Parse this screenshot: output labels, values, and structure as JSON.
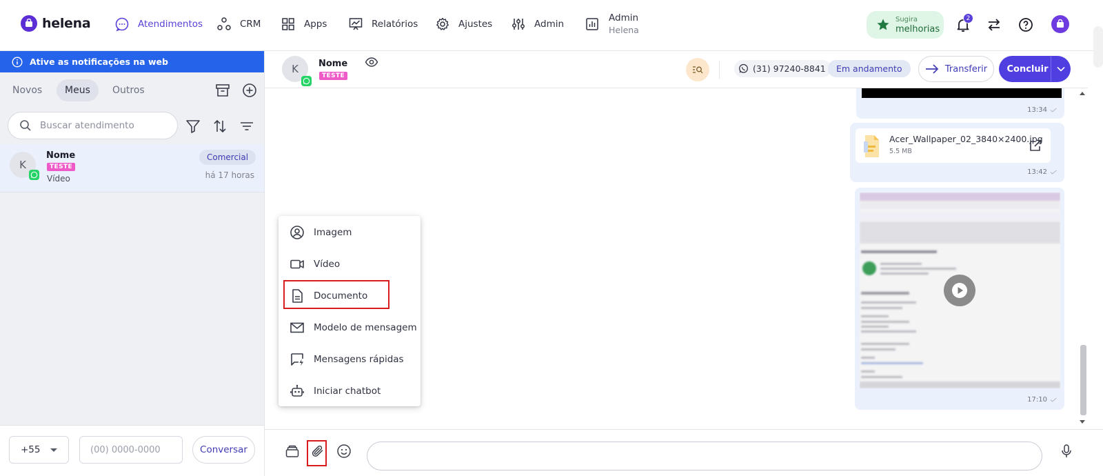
{
  "brand": {
    "name": "helena",
    "accent": "#5b3fd9"
  },
  "nav": {
    "items": [
      {
        "label": "Atendimentos",
        "icon": "chat-bubble-icon"
      },
      {
        "label": "CRM",
        "icon": "crm-nodes-icon"
      },
      {
        "label": "Apps",
        "icon": "grid-icon"
      },
      {
        "label": "Relatórios",
        "icon": "chart-board-icon"
      },
      {
        "label": "Ajustes",
        "icon": "gear-icon"
      },
      {
        "label": "Admin",
        "icon": "sliders-icon"
      }
    ],
    "account": {
      "title": "Admin",
      "subtitle": "Helena"
    },
    "suggest": {
      "line1": "Sugira",
      "line2": "melhorias"
    },
    "notifications_count": "2"
  },
  "left_panel": {
    "notify_bar": "Ative as notificações na web",
    "tabs": [
      "Novos",
      "Meus",
      "Outros"
    ],
    "active_tab": "Meus",
    "search_placeholder": "Buscar atendimento",
    "conversation": {
      "initial": "K",
      "name": "Nome",
      "tag": "TESTE",
      "last_message": "Vídeo",
      "department": "Comercial",
      "time": "há 17 horas"
    },
    "footer": {
      "ddi": "+55",
      "phone_placeholder": "(00) 0000-0000",
      "button": "Conversar"
    }
  },
  "chat_header": {
    "initial": "K",
    "name": "Nome",
    "tag": "TESTE",
    "phone": "(31) 97240-8841",
    "status": "Em andamento",
    "transfer": "Transferir",
    "conclude": "Concluir"
  },
  "messages": [
    {
      "type": "image",
      "time": "13:34"
    },
    {
      "type": "file",
      "file_name": "Acer_Wallpaper_02_3840×2400.jpg",
      "file_size": "5.5 MB",
      "time": "13:42"
    },
    {
      "type": "video",
      "time": "17:10"
    }
  ],
  "attach_menu": {
    "items": [
      {
        "label": "Imagem",
        "icon": "user-circle-icon"
      },
      {
        "label": "Vídeo",
        "icon": "video-camera-icon"
      },
      {
        "label": "Documento",
        "icon": "document-icon"
      },
      {
        "label": "Modelo de mensagem",
        "icon": "envelope-icon"
      },
      {
        "label": "Mensagens rápidas",
        "icon": "quick-message-icon"
      },
      {
        "label": "Iniciar chatbot",
        "icon": "robot-icon"
      }
    ],
    "highlighted": "Documento"
  },
  "composer": {
    "placeholder": ""
  }
}
